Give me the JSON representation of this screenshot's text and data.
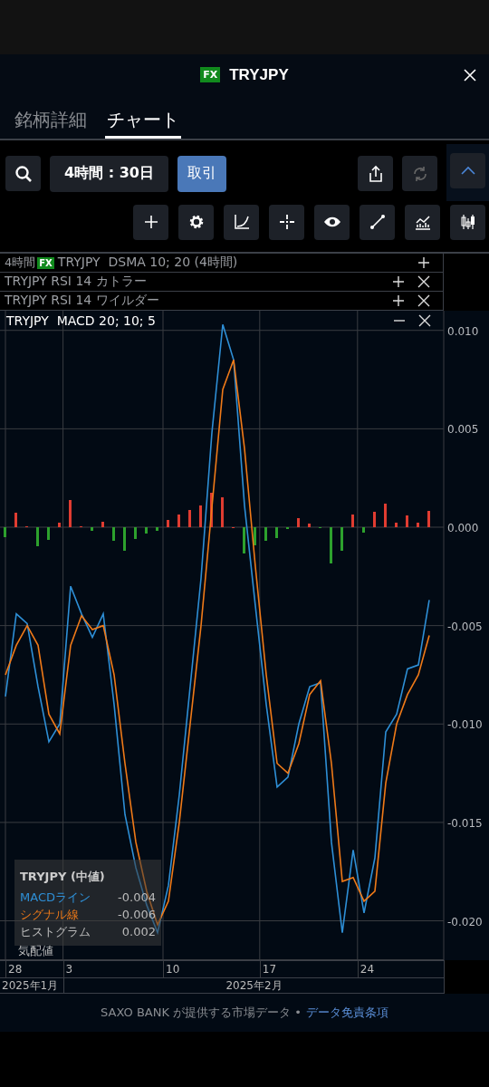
{
  "header": {
    "badge": "FX",
    "title": "TRYJPY"
  },
  "tabs": [
    {
      "label": "銘柄詳細",
      "selected": false
    },
    {
      "label": "チャート",
      "selected": true
    }
  ],
  "toolbar": {
    "period": "4時間 : 30日",
    "trade_button": "取引",
    "panel_expanded": true
  },
  "indicators": [
    {
      "prefix": "4時間",
      "badge": "FX",
      "label": "TRYJPY  DSMA 10; 20 (4時間)",
      "expanded": false,
      "removable": false
    },
    {
      "label": "TRYJPY RSI 14 カトラー",
      "expanded": false,
      "removable": true
    },
    {
      "label": "TRYJPY RSI 14 ワイルダー",
      "expanded": false,
      "removable": true
    },
    {
      "label": "TRYJPY  MACD 20; 10; 5",
      "expanded": true,
      "removable": true
    }
  ],
  "chart": {
    "chart_data": {
      "type": "line",
      "grid": true,
      "ylim": [
        -0.022,
        0.011
      ],
      "yticks": [
        {
          "value": 0.01,
          "label": "0.010"
        },
        {
          "value": 0.005,
          "label": "0.005"
        },
        {
          "value": 0,
          "label": "0.000"
        },
        {
          "value": -0.005,
          "label": "-0.005"
        },
        {
          "value": -0.01,
          "label": "-0.010"
        },
        {
          "value": -0.015,
          "label": "-0.015"
        },
        {
          "value": -0.02,
          "label": "-0.020"
        }
      ],
      "series": [
        {
          "name": "MACDライン",
          "color": "#2e8fd6",
          "values": [
            -0.0086,
            -0.0044,
            -0.0049,
            -0.0081,
            -0.0109,
            -0.01,
            -0.003,
            -0.0044,
            -0.0056,
            -0.0044,
            -0.009,
            -0.0146,
            -0.0173,
            -0.0192,
            -0.0206,
            -0.0182,
            -0.0136,
            -0.0081,
            -0.0026,
            0.0048,
            0.0103,
            0.0085,
            0.0011,
            -0.004,
            -0.009,
            -0.0132,
            -0.0127,
            -0.01,
            -0.0081,
            -0.0079,
            -0.016,
            -0.0206,
            -0.0164,
            -0.0196,
            -0.0168,
            -0.0104,
            -0.0095,
            -0.0072,
            -0.007,
            -0.0037
          ]
        },
        {
          "name": "シグナル線",
          "color": "#f07a18",
          "values": [
            -0.0075,
            -0.006,
            -0.005,
            -0.006,
            -0.0095,
            -0.0105,
            -0.006,
            -0.0045,
            -0.0052,
            -0.005,
            -0.0075,
            -0.012,
            -0.016,
            -0.0185,
            -0.0202,
            -0.019,
            -0.015,
            -0.01,
            -0.005,
            0.001,
            0.007,
            0.0085,
            0.004,
            -0.002,
            -0.0075,
            -0.012,
            -0.0125,
            -0.011,
            -0.0085,
            -0.0078,
            -0.012,
            -0.018,
            -0.0178,
            -0.019,
            -0.0185,
            -0.013,
            -0.01,
            -0.0085,
            -0.0075,
            -0.0055
          ]
        }
      ]
    },
    "x_labels": [
      "28",
      "3",
      "10",
      "17",
      "24"
    ],
    "tooltip": {
      "title": "TRYJPY (中値)",
      "values": [
        "-0.004",
        "-0.006",
        "0.002"
      ],
      "histogram_label": "ヒストグラム"
    },
    "quote_label": "気配値",
    "months": [
      "2025年1月",
      "2025年2月"
    ]
  },
  "footer": {
    "text": "SAXO BANK が提供する市場データ •",
    "link": "データ免責条項"
  }
}
